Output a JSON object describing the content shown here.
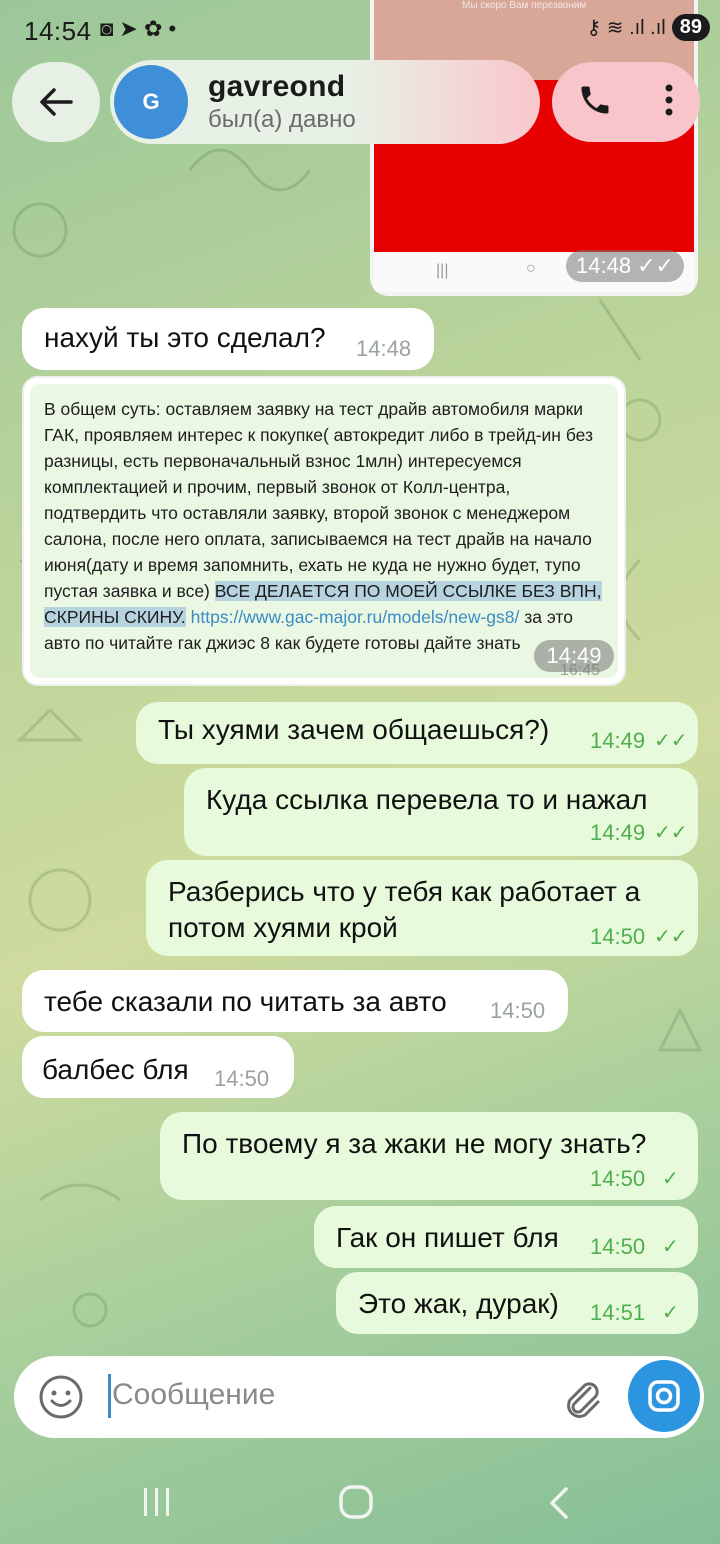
{
  "status_bar": {
    "time": "14:54",
    "left_icons": "◙ ➤ ✿ •",
    "right_icons": "⚷ ≋ .ıl .ıl",
    "battery": "89"
  },
  "header": {
    "avatar_letter": "G",
    "name": "gavreond",
    "status": "был(а) давно"
  },
  "image_message": {
    "overlay_text": "Мы скоро Вам перезвоним",
    "time": "14:48",
    "nav_buttons": [
      "|||",
      "○"
    ]
  },
  "messages": [
    {
      "dir": "in",
      "text": "нахуй ты это сделал?",
      "time": "14:48"
    },
    {
      "dir": "out",
      "text": "Ты хуями зачем общаешься?)",
      "time": "14:49",
      "read": "✓✓"
    },
    {
      "dir": "out",
      "text": "Куда ссылка перевела то и нажал",
      "time": "14:49",
      "read": "✓✓"
    },
    {
      "dir": "out",
      "lines": [
        "Разберись что у тебя как работает а",
        "потом хуями крой"
      ],
      "time": "14:50",
      "read": "✓✓"
    },
    {
      "dir": "in",
      "text": "тебе сказали по читать за авто",
      "time": "14:50"
    },
    {
      "dir": "in",
      "text": "балбес бля",
      "time": "14:50"
    },
    {
      "dir": "out",
      "text": "По твоему я за жаки не могу знать?",
      "time": "14:50",
      "read": "✓"
    },
    {
      "dir": "out",
      "text": "Гак он пишет бля",
      "time": "14:50",
      "read": "✓"
    },
    {
      "dir": "out",
      "text": "Это жак, дурак)",
      "time": "14:51",
      "read": "✓"
    }
  ],
  "forwarded_screenshot": {
    "part1": "В общем суть: оставляем заявку на тест драйв автомобиля марки ГАК, проявляем интерес к покупке( автокредит либо в трейд-ин без разницы, есть первоначальный взнос 1млн) интересуемся комплектацией и прочим, первый звонок от Колл-центра, подтвердить что оставляли заявку, второй звонок с менеджером салона, после него оплата, записываемся на тест драйв на начало июня(дату и время запомнить, ехать не куда не нужно будет, тупо пустая заявка и все) ",
    "highlight": "ВСЕ ДЕЛАЕТСЯ ПО МОЕЙ ССЫЛКЕ БЕЗ ВПН, СКРИНЫ СКИНУ.",
    "link": " https://www.gac-major.ru/models/new-gs8/",
    "part2": " за это авто по читайте гак джиэс 8 как будете готовы дайте знать",
    "inner_time": "16:45",
    "time": "14:49"
  },
  "composer": {
    "placeholder": "Сообщение"
  },
  "colors": {
    "incoming": "#ffffff",
    "outgoing": "#e7fadb",
    "accent": "#2b95e0",
    "check": "#4fae4e"
  }
}
